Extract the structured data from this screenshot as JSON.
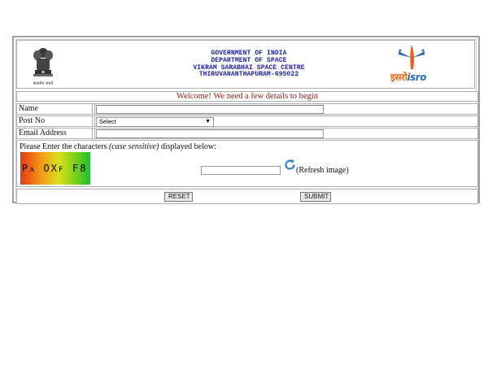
{
  "header": {
    "emblem_icon": "state-emblem-icon",
    "emblem_caption": "सत्यमेव जयते",
    "lines": [
      "GOVERNMENT OF INDIA",
      "DEPARTMENT OF SPACE",
      "VIKRAM SARABHAI SPACE CENTRE",
      "THIRUVANANTHAPURAM-695022"
    ],
    "isro_logo_icon": "isro-logo-icon",
    "isro_hindi": "इसरो",
    "isro_english": "isro",
    "text_color": "#1a1aa8"
  },
  "form": {
    "welcome": "Welcome! We need a few details to begin",
    "welcome_color": "#8b1b1b",
    "name_label": "Name",
    "name_value": "",
    "post_label": "Post No",
    "post_selected": "Select",
    "email_label": "Email Address",
    "email_value": "",
    "captcha_prompt_before": "Please Enter the characters ",
    "captcha_prompt_em": "(case sensitive)",
    "captcha_prompt_after": " displayed below:",
    "captcha_text": "Pᴀ OXꜰ F8",
    "captcha_value": "",
    "refresh_label": "(Refresh image)",
    "refresh_icon": "refresh-icon",
    "reset_label": "RESET",
    "submit_label": "SUBMIT"
  }
}
